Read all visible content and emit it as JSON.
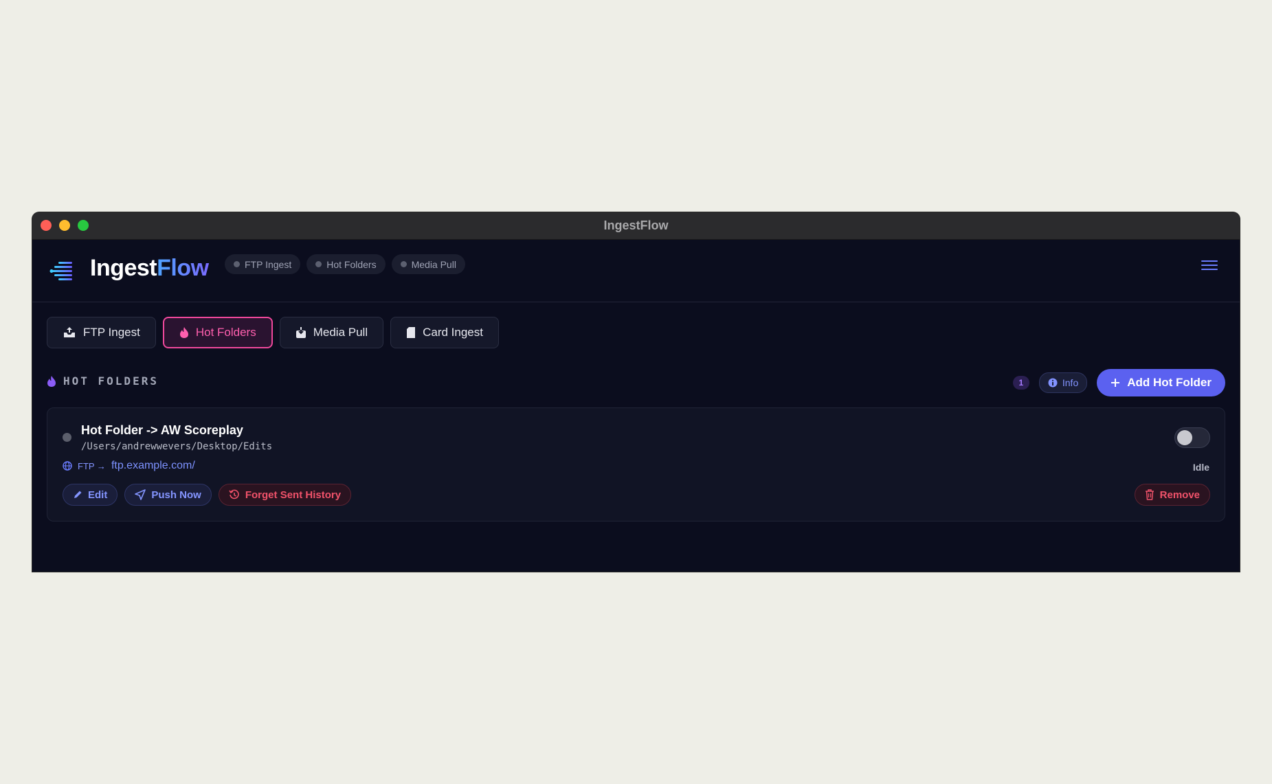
{
  "window": {
    "title": "IngestFlow"
  },
  "brand": {
    "part1": "Ingest",
    "part2": "Flow"
  },
  "status_pills": [
    {
      "label": "FTP Ingest"
    },
    {
      "label": "Hot Folders"
    },
    {
      "label": "Media Pull"
    }
  ],
  "tabs": [
    {
      "label": "FTP Ingest",
      "icon": "tray-upload-icon"
    },
    {
      "label": "Hot Folders",
      "icon": "flame-icon",
      "active": true
    },
    {
      "label": "Media Pull",
      "icon": "download-box-icon"
    },
    {
      "label": "Card Ingest",
      "icon": "sd-card-icon"
    }
  ],
  "section": {
    "title": "HOT FOLDERS",
    "count": "1",
    "info_label": "Info",
    "add_label": "Add Hot Folder"
  },
  "hot_folder": {
    "name": "Hot Folder -> AW Scoreplay",
    "path": "/Users/andrewwevers/Desktop/Edits",
    "protocol": "FTP →",
    "destination": "ftp.example.com/",
    "state": "Idle",
    "enabled": false,
    "actions": {
      "edit": "Edit",
      "push": "Push Now",
      "forget": "Forget Sent History",
      "remove": "Remove"
    }
  },
  "colors": {
    "accent": "#5b61f0",
    "active_tab": "#f0489c",
    "danger": "#f0526a",
    "background": "#0b0d1e"
  }
}
